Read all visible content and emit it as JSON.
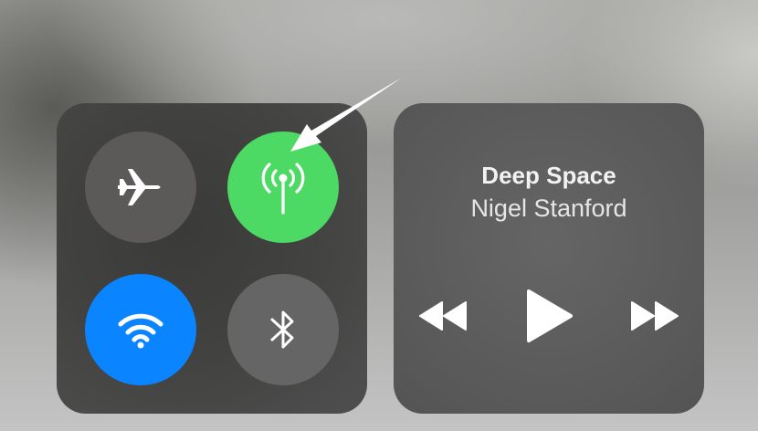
{
  "control_center": {
    "connectivity": {
      "toggles": [
        {
          "name": "airplane-mode",
          "icon": "airplane-icon",
          "active": false,
          "color": "#5c5a58"
        },
        {
          "name": "cellular-data",
          "icon": "antenna-icon",
          "active": true,
          "color": "#4cd964"
        },
        {
          "name": "wifi",
          "icon": "wifi-icon",
          "active": true,
          "color": "#0a84ff"
        },
        {
          "name": "bluetooth",
          "icon": "bluetooth-icon",
          "active": false,
          "color": "#666565"
        }
      ]
    },
    "now_playing": {
      "title": "Deep Space",
      "artist": "Nigel Stanford",
      "controls": [
        "rewind-icon",
        "play-icon",
        "fast-forward-icon"
      ]
    }
  },
  "annotation": {
    "type": "arrow",
    "color": "#ffffff",
    "points_to": "cellular-toggle"
  }
}
